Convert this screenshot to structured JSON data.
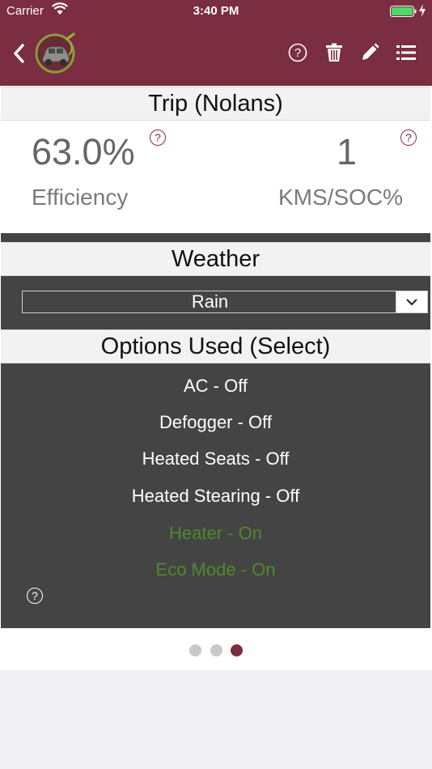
{
  "status_bar": {
    "carrier": "Carrier",
    "time": "3:40 PM"
  },
  "nav": {
    "back_icon": "chevron-left-icon",
    "logo_icon": "ev-car-logo-icon",
    "actions": [
      "help-icon",
      "trash-icon",
      "pencil-icon",
      "list-icon"
    ]
  },
  "trip": {
    "title": "Trip (Nolans)"
  },
  "stats": {
    "efficiency_value": "63.0%",
    "efficiency_label": "Efficiency",
    "kms_value": "1",
    "kms_label": "KMS/SOC%",
    "help_glyph": "?"
  },
  "weather": {
    "title": "Weather",
    "selected": "Rain"
  },
  "options": {
    "title": "Options Used (Select)",
    "items": [
      {
        "label": "AC - Off",
        "state": "off"
      },
      {
        "label": "Defogger - Off",
        "state": "off"
      },
      {
        "label": "Heated Seats - Off",
        "state": "off"
      },
      {
        "label": "Heated Stearing - Off",
        "state": "off"
      },
      {
        "label": "Heater - On",
        "state": "on"
      },
      {
        "label": "Eco Mode - On",
        "state": "on"
      }
    ],
    "help_glyph": "?"
  },
  "pager": {
    "pages": 3,
    "current": 3
  },
  "colors": {
    "header": "#7b2d42",
    "panel": "#444444",
    "on_text": "#4f8a2c",
    "help_icon": "#8c2a3c"
  }
}
